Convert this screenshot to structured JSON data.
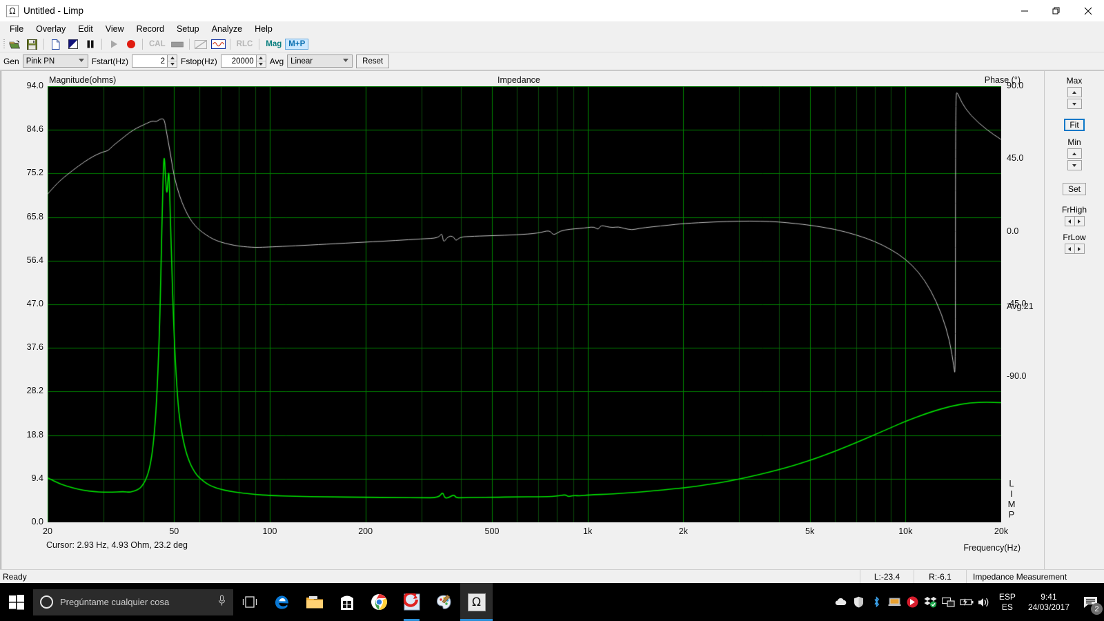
{
  "window": {
    "title": "Untitled - Limp",
    "icon": "omega-icon",
    "controls": {
      "minimize": "minimize-icon",
      "restore": "restore-icon",
      "close": "close-icon"
    }
  },
  "menu": {
    "items": [
      "File",
      "Overlay",
      "Edit",
      "View",
      "Record",
      "Setup",
      "Analyze",
      "Help"
    ]
  },
  "toolbar": {
    "buttons": [
      {
        "name": "open-icon",
        "label": ""
      },
      {
        "name": "save-icon",
        "label": ""
      },
      {
        "name": "new-page-icon",
        "label": ""
      },
      {
        "name": "flag-icon",
        "label": ""
      },
      {
        "name": "pause-icon",
        "label": ""
      },
      {
        "name": "play-icon",
        "label": ""
      },
      {
        "name": "record-icon",
        "label": ""
      }
    ],
    "cal_label": "CAL",
    "rlc_label": "RLC",
    "mag_label": "Mag",
    "mplusp_label": "M+P"
  },
  "params": {
    "gen_label": "Gen",
    "gen_value": "Pink PN",
    "fstart_label": "Fstart(Hz)",
    "fstart_value": "2",
    "fstop_label": "Fstop(Hz)",
    "fstop_value": "20000",
    "avg_label": "Avg",
    "avg_value": "Linear",
    "reset_label": "Reset"
  },
  "plot": {
    "title": "Impedance",
    "left_axis_title": "Magnitude(ohms)",
    "right_axis_title": "Phase (°)",
    "x_axis_title": "Frequency(Hz)",
    "avg_text": "Avg:21",
    "watermark": "LIMP",
    "cursor_text": "Cursor: 2.93 Hz, 4.93 Ohm, 23.2 deg"
  },
  "rightpanel": {
    "max_label": "Max",
    "fit_label": "Fit",
    "min_label": "Min",
    "set_label": "Set",
    "frhigh_label": "FrHigh",
    "frlow_label": "FrLow"
  },
  "statusbar": {
    "ready": "Ready",
    "left_level": "L:-23.4",
    "right_level": "R:-6.1",
    "message": "Impedance Measurement"
  },
  "taskbar": {
    "start": "start-icon",
    "search_placeholder": "Pregúntame cualquier cosa",
    "mic": "microphone-icon",
    "apps": [
      {
        "name": "task-view-icon"
      },
      {
        "name": "edge-icon"
      },
      {
        "name": "file-explorer-icon"
      },
      {
        "name": "store-icon"
      },
      {
        "name": "chrome-icon"
      },
      {
        "name": "media-player-icon"
      },
      {
        "name": "paint-icon"
      },
      {
        "name": "limp-app-icon"
      }
    ],
    "tray": [
      {
        "name": "onedrive-icon"
      },
      {
        "name": "defender-icon"
      },
      {
        "name": "bluetooth-icon"
      },
      {
        "name": "laptop-icon"
      },
      {
        "name": "shield-arrow-icon"
      },
      {
        "name": "dropbox-icon"
      },
      {
        "name": "network-icon"
      },
      {
        "name": "battery-icon"
      },
      {
        "name": "volume-icon"
      }
    ],
    "language_line1": "ESP",
    "language_line2": "ES",
    "clock_time": "9:41",
    "clock_date": "24/03/2017",
    "notification_count": "2"
  },
  "chart_data": {
    "type": "line",
    "title": "Impedance",
    "xlabel": "Frequency(Hz)",
    "ylabel": "Magnitude(ohms)",
    "y2label": "Phase (°)",
    "x_scale": "log",
    "xlim": [
      20,
      20000
    ],
    "ylim": [
      0.0,
      94.0
    ],
    "y2lim": [
      -180.0,
      90.0
    ],
    "x_ticks": [
      20,
      50,
      100,
      200,
      500,
      1000,
      2000,
      5000,
      10000,
      20000
    ],
    "x_tick_labels": [
      "20",
      "50",
      "100",
      "200",
      "500",
      "1k",
      "2k",
      "5k",
      "10k",
      "20k"
    ],
    "y_ticks": [
      0.0,
      9.4,
      18.8,
      28.2,
      37.6,
      47.0,
      56.4,
      65.8,
      75.2,
      84.6,
      94.0
    ],
    "y_tick_labels": [
      "0.0",
      "9.4",
      "18.8",
      "28.2",
      "37.6",
      "47.0",
      "56.4",
      "65.8",
      "75.2",
      "84.6",
      "94.0"
    ],
    "y2_ticks": [
      90.0,
      45.0,
      0.0,
      -45.0,
      -90.0
    ],
    "y2_tick_labels": [
      "90.0",
      "45.0",
      "0.0",
      "-45.0",
      "-90.0"
    ],
    "grid": true,
    "legend": "none",
    "background": "#000000",
    "grid_color": "#008000",
    "series": [
      {
        "name": "Magnitude",
        "color": "#00e000",
        "axis": "left",
        "unit": "ohms",
        "points": [
          [
            20,
            9.6
          ],
          [
            22,
            8.2
          ],
          [
            24,
            7.4
          ],
          [
            26,
            6.9
          ],
          [
            28,
            6.6
          ],
          [
            30,
            6.5
          ],
          [
            32,
            6.5
          ],
          [
            34,
            6.6
          ],
          [
            35,
            6.6
          ],
          [
            36,
            6.5
          ],
          [
            37,
            6.6
          ],
          [
            38,
            6.9
          ],
          [
            39,
            7.3
          ],
          [
            40,
            8.2
          ],
          [
            41,
            9.6
          ],
          [
            42,
            12.0
          ],
          [
            43,
            16.5
          ],
          [
            44,
            25.0
          ],
          [
            45,
            41.0
          ],
          [
            45.5,
            56.0
          ],
          [
            46,
            70.0
          ],
          [
            46.3,
            77.0
          ],
          [
            46.6,
            79.2
          ],
          [
            47,
            74.0
          ],
          [
            47.5,
            70.0
          ],
          [
            48,
            76.0
          ],
          [
            48.3,
            74.0
          ],
          [
            49,
            58.0
          ],
          [
            50,
            40.0
          ],
          [
            51,
            29.0
          ],
          [
            52,
            22.0
          ],
          [
            54,
            16.0
          ],
          [
            56,
            12.8
          ],
          [
            58,
            10.8
          ],
          [
            60,
            9.6
          ],
          [
            63,
            8.4
          ],
          [
            66,
            7.7
          ],
          [
            70,
            7.1
          ],
          [
            75,
            6.7
          ],
          [
            80,
            6.4
          ],
          [
            90,
            6.0
          ],
          [
            100,
            5.8
          ],
          [
            120,
            5.6
          ],
          [
            150,
            5.5
          ],
          [
            200,
            5.4
          ],
          [
            250,
            5.35
          ],
          [
            300,
            5.3
          ],
          [
            340,
            5.3
          ],
          [
            350,
            6.6
          ],
          [
            355,
            5.2
          ],
          [
            365,
            5.3
          ],
          [
            380,
            6.0
          ],
          [
            385,
            5.3
          ],
          [
            400,
            5.3
          ],
          [
            450,
            5.4
          ],
          [
            500,
            5.4
          ],
          [
            600,
            5.5
          ],
          [
            700,
            5.5
          ],
          [
            800,
            5.6
          ],
          [
            850,
            6.0
          ],
          [
            870,
            5.5
          ],
          [
            900,
            5.8
          ],
          [
            950,
            5.7
          ],
          [
            1000,
            5.9
          ],
          [
            1200,
            6.1
          ],
          [
            1500,
            6.6
          ],
          [
            2000,
            7.4
          ],
          [
            2500,
            8.3
          ],
          [
            3000,
            9.3
          ],
          [
            4000,
            11.3
          ],
          [
            5000,
            13.3
          ],
          [
            6000,
            15.3
          ],
          [
            7000,
            17.2
          ],
          [
            8000,
            18.9
          ],
          [
            9000,
            20.4
          ],
          [
            10000,
            21.8
          ],
          [
            12000,
            23.8
          ],
          [
            14000,
            25.1
          ],
          [
            16000,
            25.8
          ],
          [
            18000,
            25.9
          ],
          [
            20000,
            25.8
          ]
        ]
      },
      {
        "name": "Phase",
        "color": "#c8c8c8",
        "axis": "right",
        "unit": "deg",
        "points": [
          [
            20,
            23.2
          ],
          [
            21,
            28.0
          ],
          [
            22,
            32.0
          ],
          [
            24,
            38.0
          ],
          [
            26,
            43.0
          ],
          [
            28,
            47.0
          ],
          [
            30,
            49.5
          ],
          [
            31,
            50.0
          ],
          [
            32,
            53.0
          ],
          [
            34,
            57.0
          ],
          [
            36,
            61.0
          ],
          [
            38,
            64.0
          ],
          [
            40,
            66.0
          ],
          [
            42,
            68.0
          ],
          [
            43,
            68.5
          ],
          [
            44,
            68.0
          ],
          [
            45,
            69.5
          ],
          [
            46,
            70.0
          ],
          [
            46.6,
            69.0
          ],
          [
            47,
            65.0
          ],
          [
            48,
            55.0
          ],
          [
            49,
            45.0
          ],
          [
            50,
            34.0
          ],
          [
            52,
            22.0
          ],
          [
            54,
            14.0
          ],
          [
            56,
            8.0
          ],
          [
            58,
            4.0
          ],
          [
            60,
            1.0
          ],
          [
            63,
            -2.0
          ],
          [
            66,
            -4.5
          ],
          [
            70,
            -6.5
          ],
          [
            75,
            -8.0
          ],
          [
            80,
            -9.0
          ],
          [
            85,
            -9.5
          ],
          [
            90,
            -9.8
          ],
          [
            95,
            -9.7
          ],
          [
            100,
            -9.5
          ],
          [
            120,
            -8.8
          ],
          [
            150,
            -7.8
          ],
          [
            200,
            -6.5
          ],
          [
            250,
            -5.5
          ],
          [
            300,
            -4.5
          ],
          [
            340,
            -4.0
          ],
          [
            348,
            -0.5
          ],
          [
            352,
            -7.0
          ],
          [
            360,
            -4.0
          ],
          [
            370,
            -2.5
          ],
          [
            380,
            -3.5
          ],
          [
            385,
            -6.0
          ],
          [
            395,
            -3.5
          ],
          [
            420,
            -3.0
          ],
          [
            500,
            -2.5
          ],
          [
            600,
            -2.0
          ],
          [
            700,
            -1.0
          ],
          [
            760,
            1.0
          ],
          [
            780,
            -2.5
          ],
          [
            820,
            0.5
          ],
          [
            880,
            1.5
          ],
          [
            950,
            2.0
          ],
          [
            1000,
            2.5
          ],
          [
            1050,
            3.0
          ],
          [
            1080,
            1.0
          ],
          [
            1100,
            4.0
          ],
          [
            1150,
            3.0
          ],
          [
            1200,
            2.5
          ],
          [
            1250,
            3.0
          ],
          [
            1300,
            2.0
          ],
          [
            1380,
            1.0
          ],
          [
            1450,
            2.0
          ],
          [
            1600,
            3.0
          ],
          [
            1800,
            4.0
          ],
          [
            2000,
            5.0
          ],
          [
            2500,
            6.0
          ],
          [
            3000,
            6.5
          ],
          [
            3500,
            6.5
          ],
          [
            4000,
            6.0
          ],
          [
            4500,
            5.0
          ],
          [
            5000,
            4.0
          ],
          [
            6000,
            1.5
          ],
          [
            7000,
            -2.0
          ],
          [
            8000,
            -6.0
          ],
          [
            9000,
            -11.0
          ],
          [
            10000,
            -17.0
          ],
          [
            11000,
            -25.0
          ],
          [
            12000,
            -36.0
          ],
          [
            13000,
            -51.0
          ],
          [
            13800,
            -68.0
          ],
          [
            14200,
            -84.0
          ],
          [
            14350,
            -90.0
          ],
          [
            14360,
            5.0
          ],
          [
            14380,
            60.0
          ],
          [
            14420,
            84.0
          ],
          [
            14500,
            87.0
          ],
          [
            15000,
            80.0
          ],
          [
            16000,
            72.0
          ],
          [
            18000,
            63.0
          ],
          [
            20000,
            57.0
          ]
        ]
      }
    ]
  }
}
